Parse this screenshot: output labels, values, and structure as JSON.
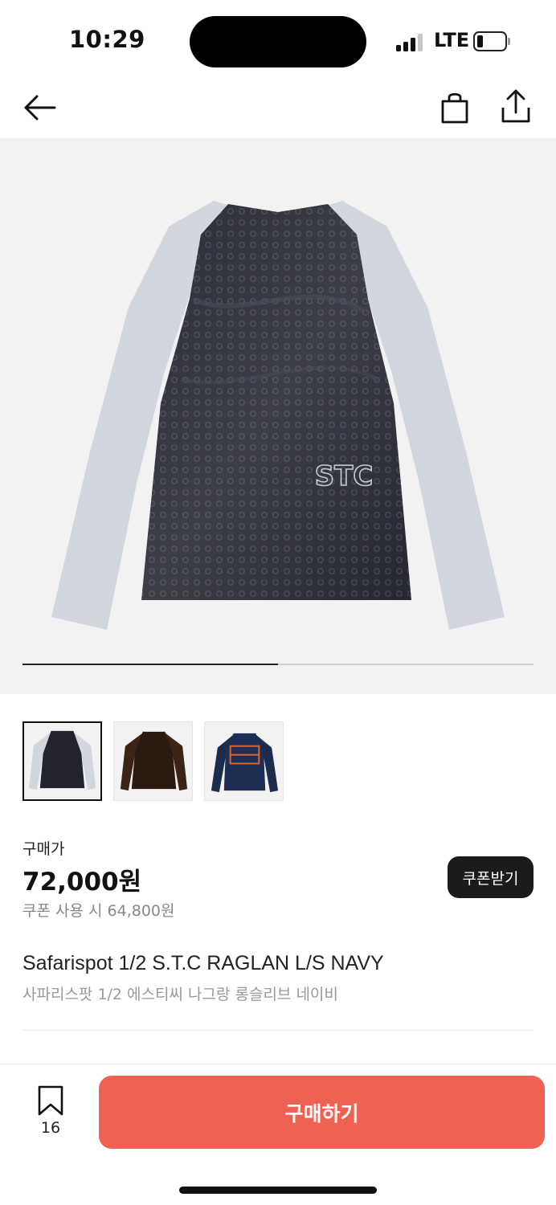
{
  "status_bar": {
    "time": "10:29",
    "network": "LTE",
    "icons": [
      "signal-icon",
      "battery-icon"
    ]
  },
  "nav": {
    "icons": [
      "back-arrow-icon",
      "shopping-bag-icon",
      "share-icon"
    ]
  },
  "gallery": {
    "progress": 0.5,
    "thumbnails": [
      {
        "name": "thumbnail-navy",
        "selected": true
      },
      {
        "name": "thumbnail-brown",
        "selected": false
      },
      {
        "name": "thumbnail-graphic",
        "selected": false
      }
    ],
    "logo_text": "STC"
  },
  "price": {
    "label": "구매가",
    "value": "72,000원",
    "coupon_price": "쿠폰 사용 시 64,800원",
    "coupon_button": "쿠폰받기"
  },
  "product": {
    "name": "Safarispot 1/2 S.T.C RAGLAN L/S NAVY",
    "name_ko": "사파리스팟 1/2 에스티씨 나그랑 롱슬리브 네이비"
  },
  "bottom_bar": {
    "bookmark_count": "16",
    "buy_label": "구매하기"
  },
  "colors": {
    "buy_button": "#ef6153",
    "coupon_button": "#1b1b1b",
    "body_navy": "#22232d",
    "sleeve_grey": "#d2d6de"
  }
}
